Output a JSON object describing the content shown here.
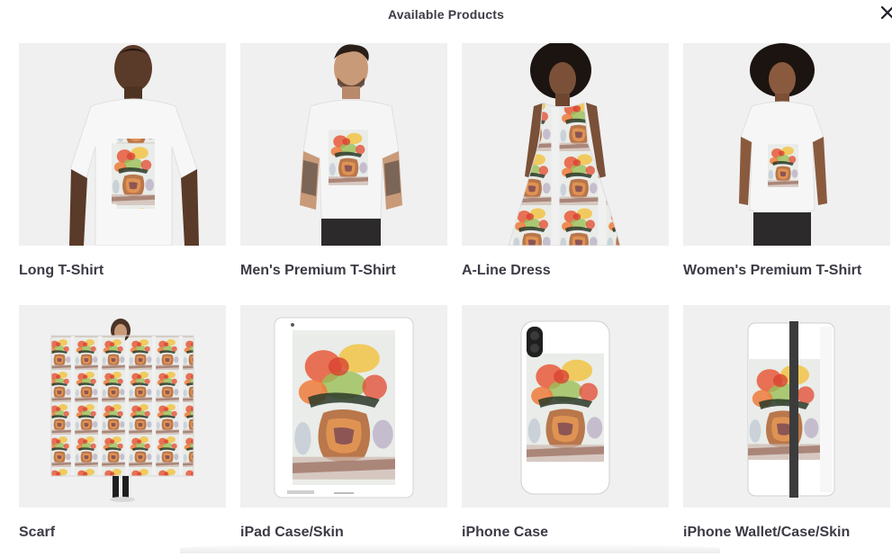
{
  "dialog": {
    "title": "Available Products",
    "close_icon": "close-icon"
  },
  "products": [
    {
      "label": "Long T-Shirt",
      "icon": "long-tshirt-image"
    },
    {
      "label": "Men's Premium T-Shirt",
      "icon": "mens-premium-tshirt-image"
    },
    {
      "label": "A-Line Dress",
      "icon": "a-line-dress-image"
    },
    {
      "label": "Women's Premium T-Shirt",
      "icon": "womens-premium-tshirt-image"
    },
    {
      "label": "Scarf",
      "icon": "scarf-image"
    },
    {
      "label": "iPad Case/Skin",
      "icon": "ipad-case-image"
    },
    {
      "label": "iPhone Case",
      "icon": "iphone-case-image"
    },
    {
      "label": "iPhone Wallet/Case/Skin",
      "icon": "iphone-wallet-image"
    }
  ],
  "colors": {
    "thumb_bg": "#f2f2f2",
    "text": "#3b3b45",
    "skin_dark": "#5a3a28",
    "skin_light": "#c99a78",
    "hair": "#1c1410",
    "shirt": "#f4f4f4",
    "pants": "#2c2a2a"
  }
}
